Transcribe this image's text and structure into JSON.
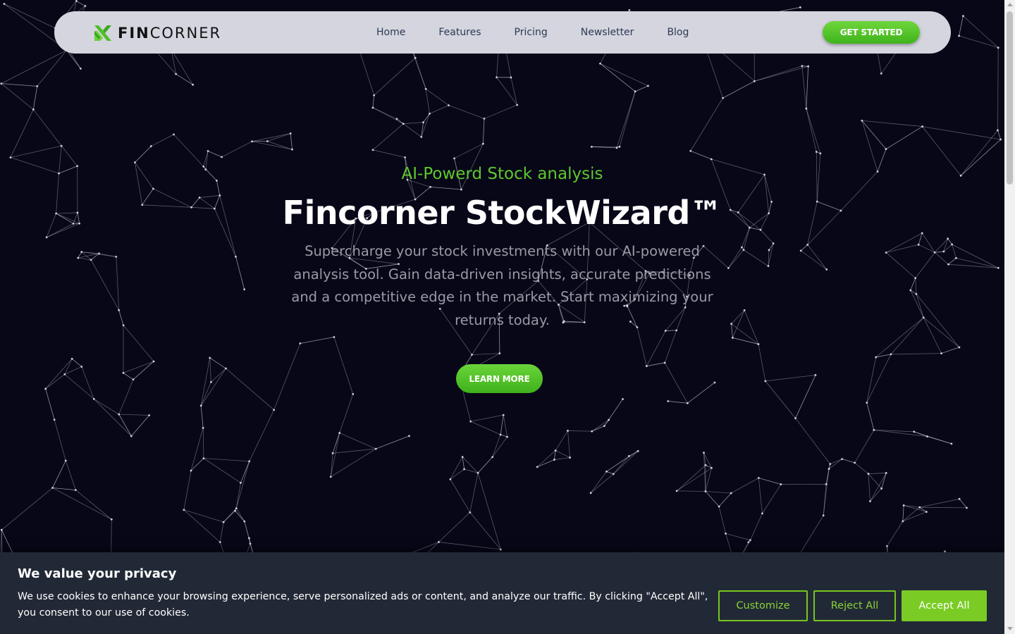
{
  "brand": {
    "name_bold": "FIN",
    "name_regular": "CORNER",
    "accent_color": "#5fc72f",
    "logo_icon": "fincorner-logo-icon"
  },
  "nav": {
    "links": [
      "Home",
      "Features",
      "Pricing",
      "Newsletter",
      "Blog"
    ],
    "cta_label": "GET STARTED"
  },
  "hero": {
    "kicker": "AI-Powerd Stock analysis",
    "title": "Fincorner StockWizard™",
    "description": "Supercharge your stock investments with our AI-powered analysis tool. Gain data-driven insights, accurate predictions and a competitive edge in the market. Start maximizing your returns today.",
    "cta_label": "LEARN MORE"
  },
  "cookie_banner": {
    "title": "We value your privacy",
    "text": "We use cookies to enhance your browsing experience, serve personalized ads or content, and analyze our traffic. By clicking \"Accept All\", you consent to our use of cookies.",
    "customize_label": "Customize",
    "reject_label": "Reject All",
    "accept_label": "Accept All",
    "button_color": "#7acc24"
  }
}
